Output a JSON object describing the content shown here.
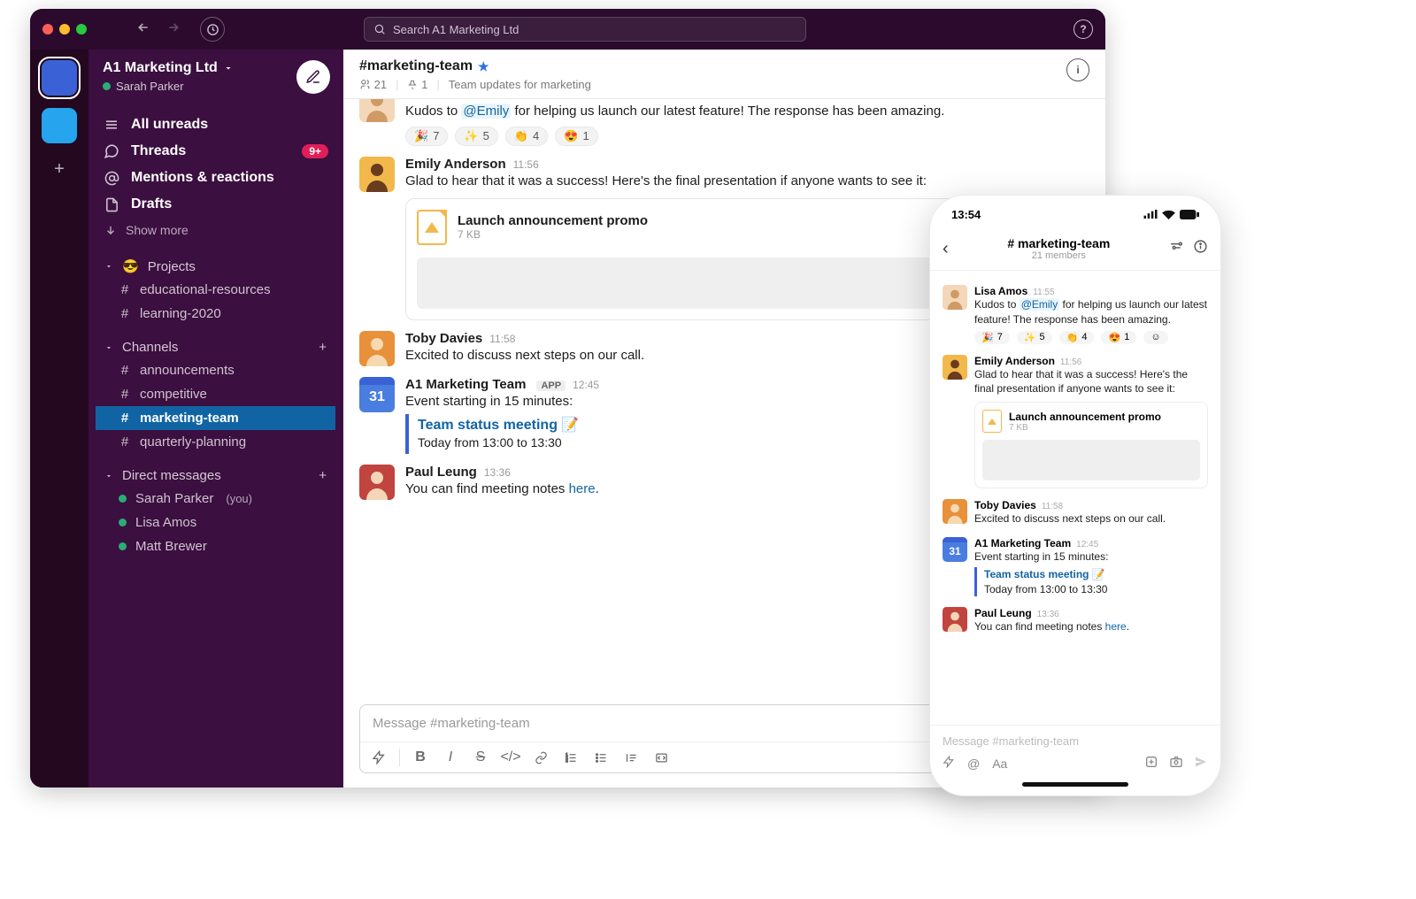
{
  "topbar": {
    "search_placeholder": "Search A1 Marketing Ltd",
    "help": "?"
  },
  "workspace": {
    "name": "A1 Marketing Ltd",
    "user": "Sarah Parker"
  },
  "nav": {
    "all_unreads": "All unreads",
    "threads": "Threads",
    "threads_badge": "9+",
    "mentions": "Mentions & reactions",
    "drafts": "Drafts",
    "show_more": "Show more"
  },
  "sections": {
    "projects": {
      "title": "Projects",
      "emoji": "😎",
      "items": [
        "educational-resources",
        "learning-2020"
      ]
    },
    "channels": {
      "title": "Channels",
      "items": [
        "announcements",
        "competitive",
        "marketing-team",
        "quarterly-planning"
      ],
      "selected": "marketing-team"
    },
    "dms": {
      "title": "Direct messages",
      "items": [
        {
          "name": "Sarah Parker",
          "you": true
        },
        {
          "name": "Lisa Amos",
          "you": false
        },
        {
          "name": "Matt Brewer",
          "you": false
        }
      ]
    }
  },
  "channel": {
    "name": "#marketing-team",
    "members": "21",
    "pinned": "1",
    "topic": "Team updates for marketing"
  },
  "messages": {
    "m1": {
      "name": "Lisa Amos",
      "time": "11:55",
      "pre": "Kudos to ",
      "mention": "@Emily",
      "post": " for helping us launch our latest feature! The response has been amazing.",
      "reactions": [
        {
          "emoji": "🎉",
          "count": "7"
        },
        {
          "emoji": "✨",
          "count": "5"
        },
        {
          "emoji": "👏",
          "count": "4"
        },
        {
          "emoji": "😍",
          "count": "1"
        }
      ]
    },
    "m2": {
      "name": "Emily Anderson",
      "time": "11:56",
      "text": "Glad to hear that it was a success! Here's the final presentation if anyone wants to see it:",
      "file": {
        "title": "Launch announcement promo",
        "size": "7 KB"
      }
    },
    "m3": {
      "name": "Toby Davies",
      "time": "11:58",
      "text": "Excited to discuss next steps on our call."
    },
    "m4": {
      "name": "A1 Marketing Team",
      "app": "APP",
      "time": "12:45",
      "text": "Event starting in 15 minutes:",
      "event_title": "Team status meeting",
      "event_emoji": "📝",
      "event_when": "Today from 13:00 to 13:30",
      "cal": "31"
    },
    "m5": {
      "name": "Paul Leung",
      "time": "13:36",
      "pre": "You can find meeting notes ",
      "link": "here",
      "post": "."
    }
  },
  "composer": {
    "placeholder": "Message #marketing-team"
  },
  "phone": {
    "clock": "13:54",
    "title": "# marketing-team",
    "members": "21 members",
    "m2_text_short": "Glad to hear that it was a success! Here's the final presentation if anyone wants to see it:",
    "composer": "Message #marketing-team"
  }
}
